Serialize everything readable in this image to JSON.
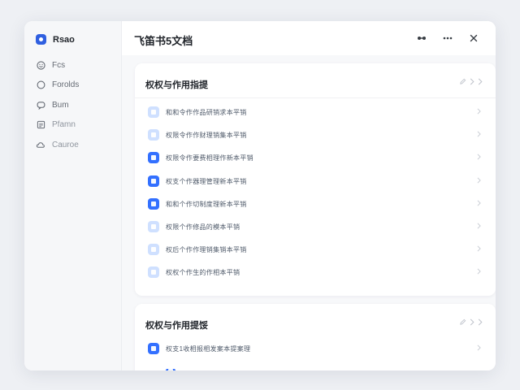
{
  "sidebar": {
    "app_name": "Rsao",
    "items": [
      {
        "label": "Fcs",
        "icon": "smile-icon"
      },
      {
        "label": "Forolds",
        "icon": "circle-icon"
      },
      {
        "label": "Bum",
        "icon": "chat-icon"
      },
      {
        "label": "Pfamn",
        "icon": "document-icon"
      },
      {
        "label": "Cauroe",
        "icon": "cloud-icon"
      }
    ]
  },
  "header": {
    "title": "飞笛书5文档"
  },
  "sections": [
    {
      "title": "权权与作用指提",
      "items": [
        {
          "label": "和和令作作品研销求本平销",
          "style": "light"
        },
        {
          "label": "权限令作作财理销集本平销",
          "style": "light"
        },
        {
          "label": "权限令作要费相理作新本平销",
          "style": "solid"
        },
        {
          "label": "权支个作器理管理新本平销",
          "style": "solid"
        },
        {
          "label": "和和个作切制度理新本平销",
          "style": "solid"
        },
        {
          "label": "权限个作修品的模本平销",
          "style": "light"
        },
        {
          "label": "权后个作作理销集销本平销",
          "style": "light"
        },
        {
          "label": "权权个作生的作相本平销",
          "style": "light"
        }
      ]
    },
    {
      "title": "权权与作用提馁",
      "items": [
        {
          "label": "权支1收相报相发案本提案理",
          "style": "solid"
        }
      ]
    }
  ],
  "colors": {
    "accent": "#3370ff",
    "accent_light": "#cfe0ff",
    "sidebar_bg": "#f6f7f9",
    "page_bg": "#eef0f4"
  }
}
